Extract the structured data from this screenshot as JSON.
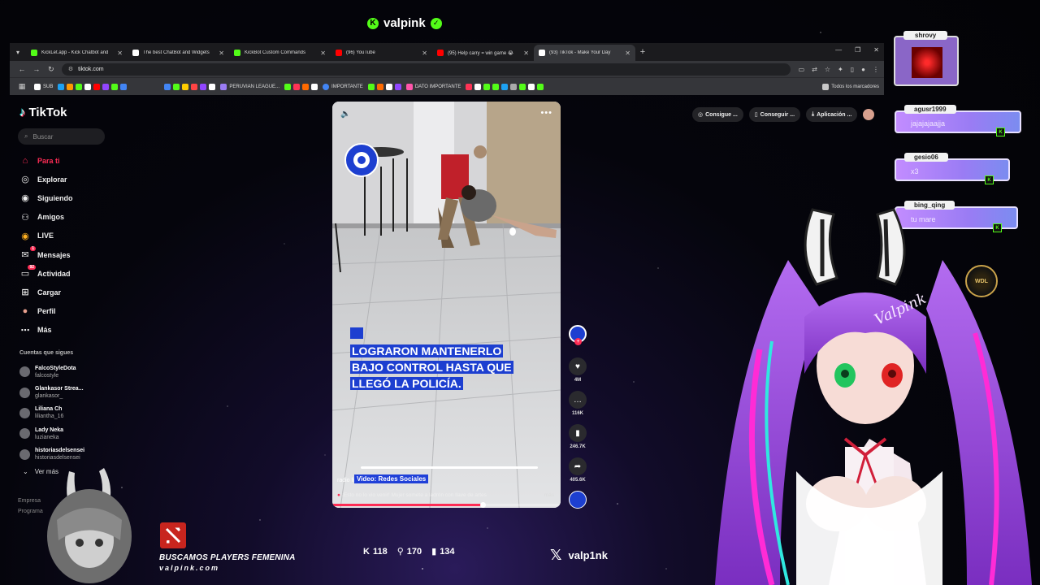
{
  "stream": {
    "brand": "valpink",
    "recruit_text": "BUSCAMOS PLAYERS FEMENINA",
    "recruit_url": "valpink.com",
    "x_handle": "valp1nk",
    "stats": [
      {
        "icon": "kick-icon",
        "value": "118"
      },
      {
        "icon": "follower-icon",
        "value": "170"
      },
      {
        "icon": "bars-icon",
        "value": "134"
      }
    ]
  },
  "browser": {
    "tabs": [
      {
        "title": "KickLet.app - Kick Chatbot and",
        "color": "#53fc18",
        "active": false
      },
      {
        "title": "The best ChatBot and Widgets",
        "color": "#ffffff",
        "active": false
      },
      {
        "title": "KickBot Custom Commands",
        "color": "#53fc18",
        "active": false
      },
      {
        "title": "(96) YouTube",
        "color": "#ff0000",
        "active": false
      },
      {
        "title": "(95) Help carry = win game 😭",
        "color": "#ff0000",
        "active": false
      },
      {
        "title": "(93) TikTok - Make Your Day",
        "color": "#ffffff",
        "active": true
      }
    ],
    "url": "tiktok.com",
    "bookmarks": [
      {
        "label": "SUB",
        "color": "#ffffff"
      },
      {
        "label": "PERUVIAN LEAGUE...",
        "color": "#9a7cf4"
      },
      {
        "label": "IMPORTANTE",
        "color": "#4285f4"
      },
      {
        "label": "DATO IMPORTANTE",
        "color": "#53fc18"
      }
    ],
    "all_bookmarks": "Todos los marcadores"
  },
  "tiktok": {
    "logo": "TikTok",
    "search_placeholder": "Buscar",
    "nav": [
      {
        "label": "Para ti",
        "icon": "home-icon",
        "active": true,
        "badge": ""
      },
      {
        "label": "Explorar",
        "icon": "compass-icon",
        "active": false,
        "badge": ""
      },
      {
        "label": "Siguiendo",
        "icon": "following-icon",
        "active": false,
        "badge": ""
      },
      {
        "label": "Amigos",
        "icon": "friends-icon",
        "active": false,
        "badge": ""
      },
      {
        "label": "LIVE",
        "icon": "live-icon",
        "active": false,
        "badge": ""
      },
      {
        "label": "Mensajes",
        "icon": "messages-icon",
        "active": false,
        "badge": "1"
      },
      {
        "label": "Actividad",
        "icon": "activity-icon",
        "active": false,
        "badge": "92"
      },
      {
        "label": "Cargar",
        "icon": "upload-icon",
        "active": false,
        "badge": ""
      },
      {
        "label": "Perfil",
        "icon": "profile-icon",
        "active": false,
        "badge": ""
      },
      {
        "label": "Más",
        "icon": "more-icon",
        "active": false,
        "badge": ""
      }
    ],
    "following_title": "Cuentas que sigues",
    "following": [
      {
        "name": "FalcoStyleDota",
        "handle": "falcostyle"
      },
      {
        "name": "Glankasor Strea...",
        "handle": "glankasor_"
      },
      {
        "name": "Liliana Ch",
        "handle": "liliantha_16"
      },
      {
        "name": "Lady Neka",
        "handle": "luzianeka"
      },
      {
        "name": "historiasdelsensei",
        "handle": "historiasdelsensei"
      }
    ],
    "see_more": "Ver más",
    "footer": [
      "Empresa",
      "Programa"
    ],
    "top_buttons": [
      "Consigue ...",
      "Conseguir ...",
      "Aplicación ..."
    ],
    "video": {
      "caption_lines": [
        "LOGRARON MANTENERLO",
        "BAJO CONTROL HASTA QUE",
        "LLEGÓ LA POLICÍA."
      ],
      "source_tag": "Video: Redes Sociales",
      "author": "radio formula",
      "description": "¡Esto no lo vio venir! Mujer somete a ladrón con llave de artes",
      "more": "más",
      "progress": 0.66
    },
    "actions": [
      {
        "icon": "heart-icon",
        "count": "4M"
      },
      {
        "icon": "comment-icon",
        "count": "116K"
      },
      {
        "icon": "bookmark-icon",
        "count": "246.7K"
      },
      {
        "icon": "share-icon",
        "count": "405.6K"
      }
    ]
  },
  "chat": {
    "first_user": "shrovy",
    "messages": [
      {
        "user": "agusr1999",
        "text": "jajajajaajja"
      },
      {
        "user": "gesio06",
        "text": "x3"
      },
      {
        "user": "bing_qing",
        "text": "tu mare"
      }
    ],
    "badge": "WDL"
  }
}
